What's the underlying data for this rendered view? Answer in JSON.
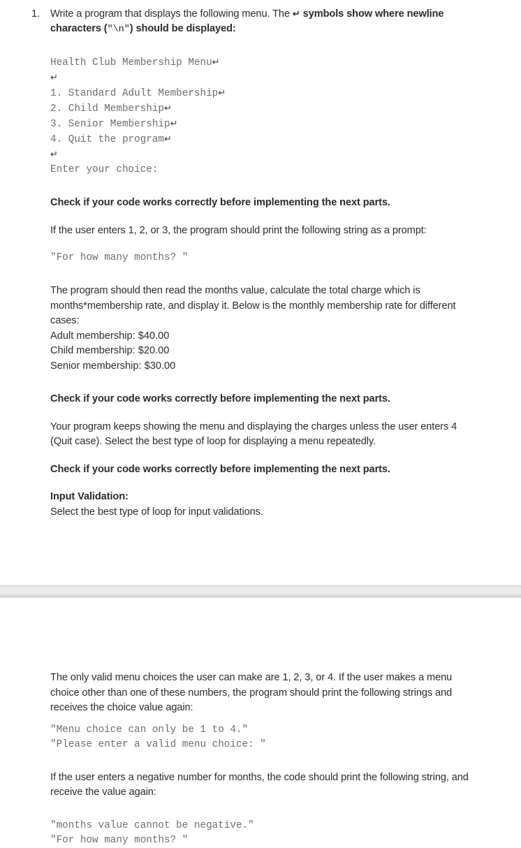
{
  "document": {
    "question_number": "1.",
    "newline_symbol": "↵",
    "intro": {
      "part_a": "Write a program that displays the following menu. The ",
      "part_b": " symbols show where newline characters (",
      "code_snippet": "\"\\n\"",
      "part_c": ") should be displayed:"
    },
    "menu_block": [
      {
        "text": "Health Club Membership Menu",
        "newline": true
      },
      {
        "text": "",
        "newline": true
      },
      {
        "text": "1. Standard Adult Membership",
        "newline": true
      },
      {
        "text": "2. Child Membership",
        "newline": true
      },
      {
        "text": "3. Senior Membership",
        "newline": true
      },
      {
        "text": "4. Quit the program",
        "newline": true
      },
      {
        "text": "",
        "newline": true
      },
      {
        "text": "Enter your choice:",
        "newline": false
      }
    ],
    "check_note_1": "Check if your code works correctly before implementing the next parts.",
    "prompt_intro": "If the user enters 1, 2, or 3, the program should print the following string as a prompt:",
    "prompt_string": "\"For how many months? \"",
    "calculation_paragraph": "The program should then read the months value, calculate the total charge which is months*membership rate, and display it. Below is the monthly membership rate for different cases:",
    "rates": [
      "Adult membership: $40.00",
      "Child membership: $20.00",
      "Senior membership: $30.00"
    ],
    "check_note_2": "Check if your code works correctly before implementing the next parts.",
    "loop_paragraph": "Your program keeps showing the menu and displaying the charges unless the user enters 4 (Quit case). Select the best type of loop for displaying a menu repeatedly.",
    "check_note_3": "Check if your code works correctly before implementing the next parts.",
    "input_validation_heading": "Input Validation:",
    "input_validation_text": "Select the best type of loop for input validations.",
    "valid_choices_paragraph": "The only valid menu choices the user can make are 1, 2, 3, or 4. If the user makes a menu choice other than one of these numbers, the program should print the following strings and receives the choice value again:",
    "invalid_choice_strings": [
      "\"Menu choice can only be 1 to 4.\"",
      "\"Please enter a valid menu choice: \""
    ],
    "negative_paragraph": "If the user enters a negative number for months, the code should print the following string, and receive the value again:",
    "negative_strings": [
      "\"months value cannot be negative.\"",
      "\"For how many months? \""
    ]
  },
  "colors": {
    "body_text": "#2b2b2b",
    "mono_text": "#6d6d6d",
    "page_background": "#ffffff",
    "divider": "#e4e5ea"
  }
}
